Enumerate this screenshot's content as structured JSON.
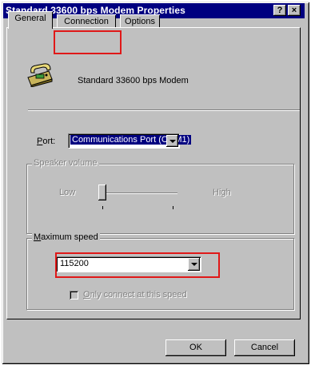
{
  "window": {
    "title": "Standard 33600 bps Modem Properties",
    "help_label": "?",
    "close_label": "×"
  },
  "tabs": [
    {
      "label": "General"
    },
    {
      "label": "Connection"
    },
    {
      "label": "Options"
    }
  ],
  "general": {
    "modem_name": "Standard 33600 bps Modem",
    "port_label": "Port:",
    "port_value": "Communications Port (COM1)",
    "speaker_group_label": "Speaker volume",
    "speaker_low": "Low",
    "speaker_high": "High",
    "speaker_level": 0,
    "max_speed_group_label": "Maximum speed",
    "max_speed_value": "115200",
    "only_connect_label": "Only connect at this speed",
    "only_connect_checked": false
  },
  "buttons": {
    "ok": "OK",
    "cancel": "Cancel"
  },
  "annotation_color": "#e01818"
}
